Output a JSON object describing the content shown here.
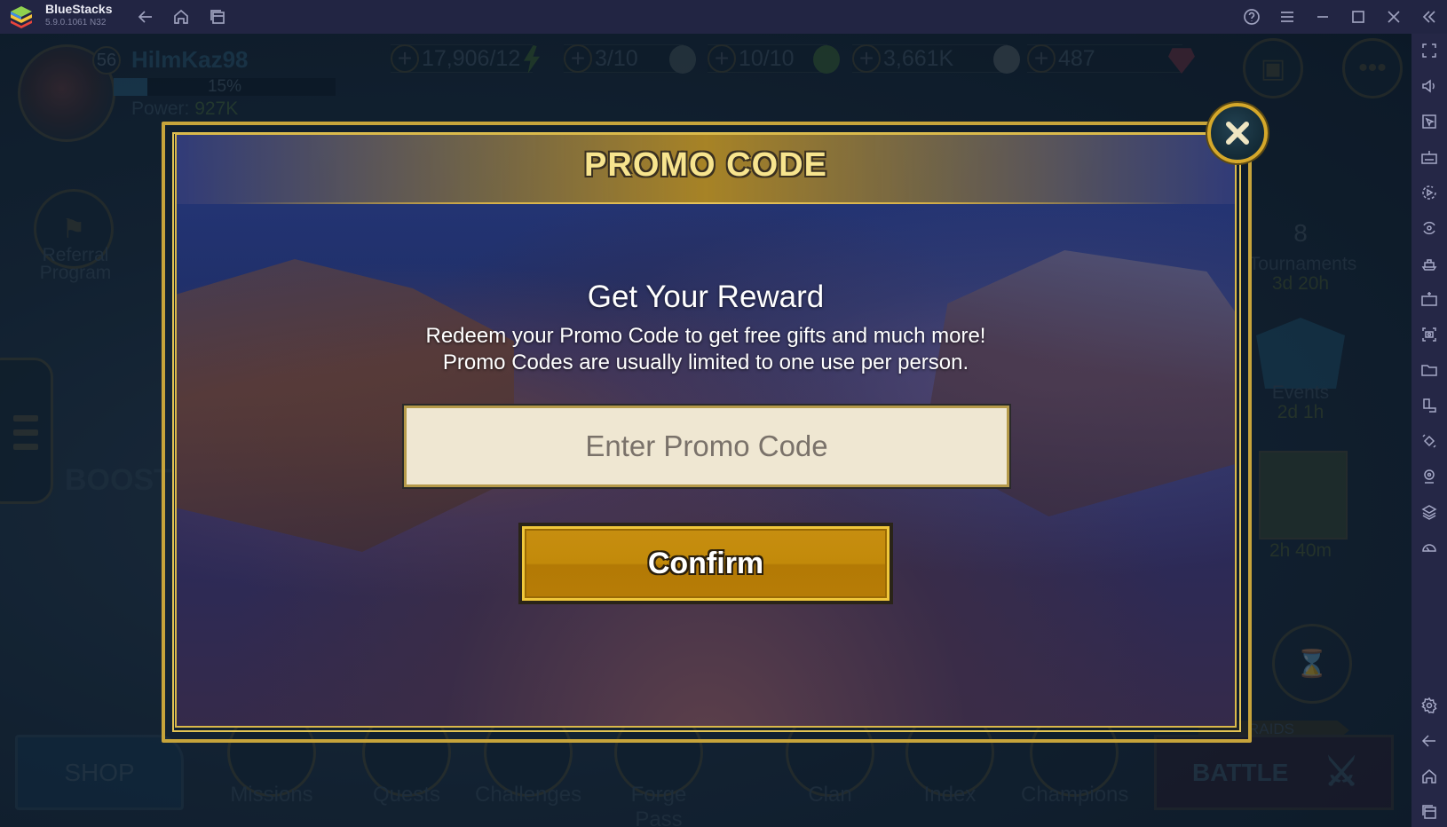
{
  "titlebar": {
    "app_name": "BlueStacks",
    "version": "5.9.0.1061 N32",
    "icons": [
      "back-icon",
      "home-icon",
      "recent-apps-icon",
      "help-icon",
      "menu-icon",
      "minimize-icon",
      "maximize-icon",
      "close-icon",
      "collapse-sidebar-icon"
    ]
  },
  "hud": {
    "level": "56",
    "player_name": "HilmKaz98",
    "xp_percent": 15,
    "xp_label": "15%",
    "power_label": "Power:",
    "power_value": "927K",
    "resources": [
      {
        "value": "17,906/12",
        "icon": "energy-icon"
      },
      {
        "value": "3/10",
        "icon": "arena-token-icon"
      },
      {
        "value": "10/10",
        "icon": "arena-token-green-icon"
      },
      {
        "value": "3,661K",
        "icon": "silver-coin-icon"
      },
      {
        "value": "487",
        "icon": "gem-icon"
      }
    ],
    "left_items": {
      "referral_label": "Referral\nProgram",
      "boost_label": "BOOST"
    },
    "right_items": [
      {
        "count": "8",
        "label": "Tournaments",
        "time": "3d 20h"
      },
      {
        "label": "Events",
        "time": "2d 1h"
      },
      {
        "label": "",
        "time": "2h 40m"
      }
    ],
    "bottom": {
      "shop": "SHOP",
      "items": [
        "Missions",
        "Quests",
        "Challenges",
        "Forge Pass",
        "Clan",
        "Index",
        "Champions"
      ],
      "raids_tag": "RAIDS",
      "battle": "BATTLE"
    }
  },
  "modal": {
    "title": "PROMO CODE",
    "heading": "Get Your Reward",
    "description_line1": "Redeem your Promo Code to get free gifts and much more!",
    "description_line2": "Promo Codes are usually limited to one use per person.",
    "input_value": "",
    "input_placeholder": "Enter Promo Code",
    "confirm_label": "Confirm"
  },
  "sidebar": {
    "icons": [
      "fullscreen-icon",
      "volume-icon",
      "pointer-icon",
      "keyboard-icon",
      "macro-record-icon",
      "rotate-icon",
      "airplane-mode-icon",
      "apk-install-icon",
      "screenshot-icon",
      "folder-icon",
      "multi-instance-icon",
      "shake-icon",
      "location-icon",
      "layers-icon",
      "performance-icon",
      "settings-icon",
      "back-icon",
      "home-icon",
      "recent-apps-icon"
    ]
  },
  "colors": {
    "titlebar_bg": "#222543",
    "gold_border": "#d5a82a",
    "confirm_button": "#c28a0a",
    "input_bg": "#efe7d2"
  }
}
